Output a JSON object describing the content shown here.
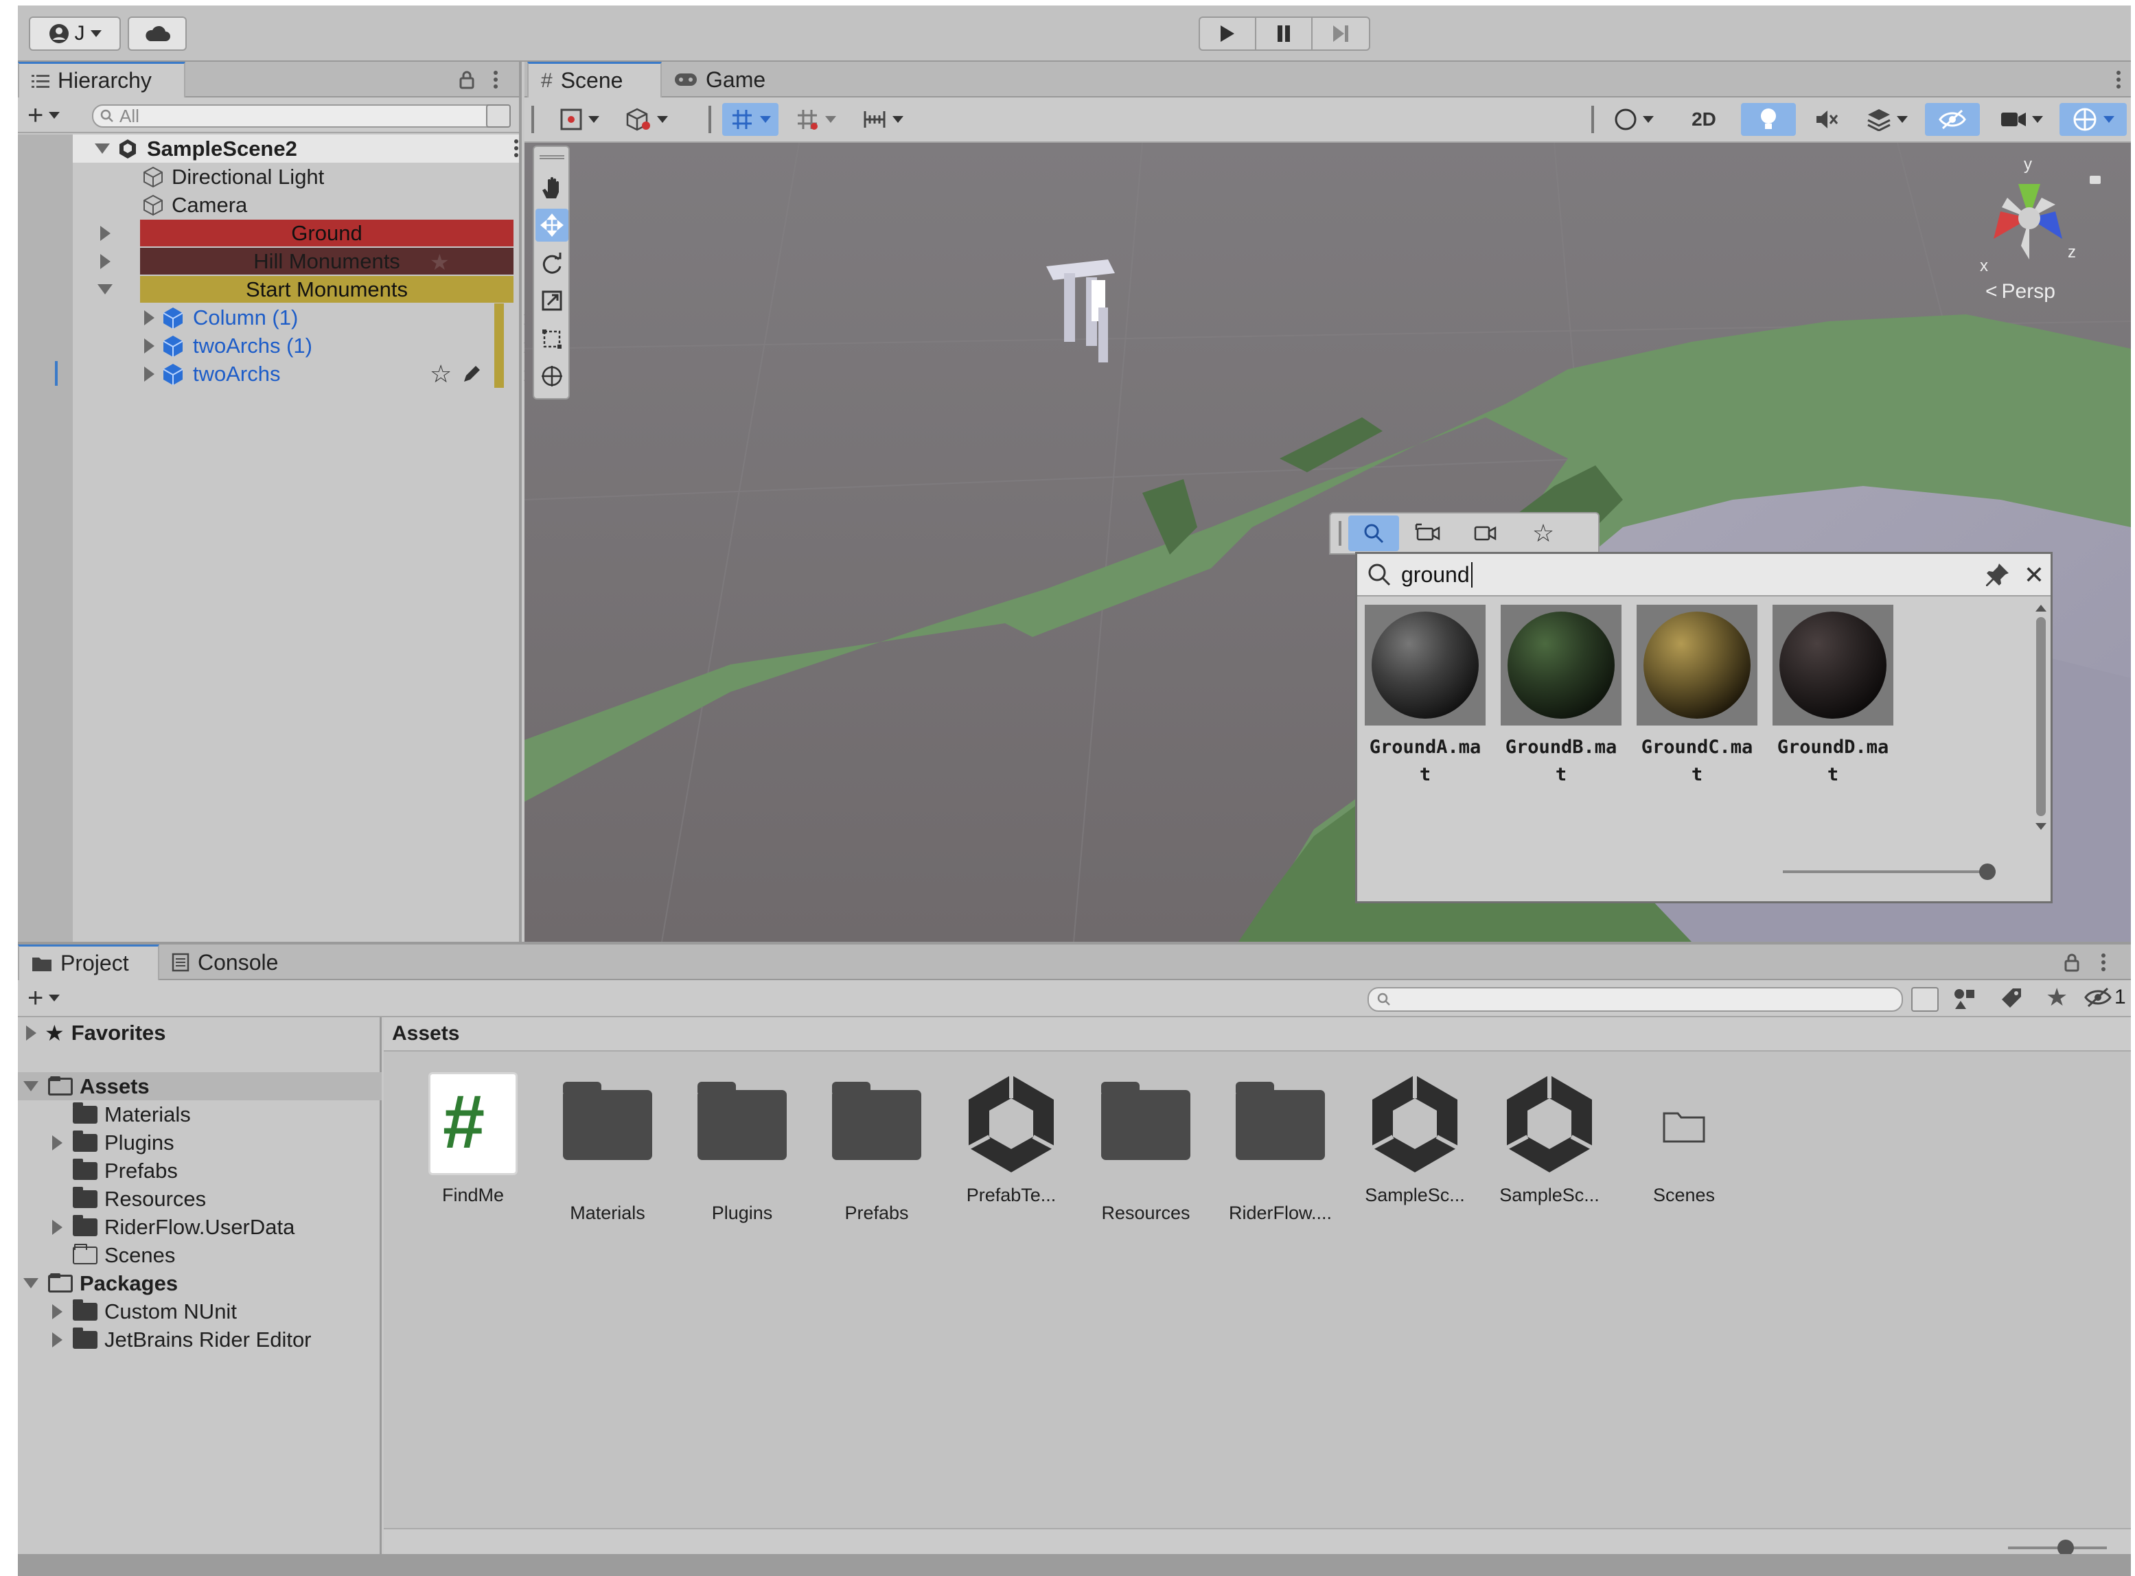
{
  "toolbar": {
    "account_label": "J",
    "cloud_icon": "cloud-icon",
    "play_icon": "play-icon",
    "pause_icon": "pause-icon",
    "step_icon": "step-icon"
  },
  "hierarchy": {
    "tab_label": "Hierarchy",
    "search_placeholder": "All",
    "scene_name": "SampleScene2",
    "items": [
      {
        "label": "Directional Light"
      },
      {
        "label": "Camera"
      },
      {
        "label": "Ground",
        "color": "#b02f2f"
      },
      {
        "label": "Hill Monuments",
        "color": "#5a2e2e"
      },
      {
        "label": "Start Monuments",
        "color": "#b5a03a"
      },
      {
        "label": "Column (1)"
      },
      {
        "label": "twoArchs (1)"
      },
      {
        "label": "twoArchs"
      }
    ]
  },
  "scene": {
    "tabs": [
      {
        "label": "Scene"
      },
      {
        "label": "Game"
      }
    ],
    "mode_2d_label": "2D",
    "persp_label": "Persp",
    "gizmo_axes": {
      "x": "x",
      "y": "y",
      "z": "z"
    }
  },
  "overlay": {
    "search_value": "ground",
    "results": [
      {
        "name": "GroundA.mat",
        "color": "#3e3e3e"
      },
      {
        "name": "GroundB.mat",
        "color": "#2a3b24"
      },
      {
        "name": "GroundC.mat",
        "color": "#6a5a2c"
      },
      {
        "name": "GroundD.mat",
        "color": "#2a2424"
      }
    ],
    "zoom_slider": 1.0
  },
  "project": {
    "tabs": [
      {
        "label": "Project"
      },
      {
        "label": "Console"
      }
    ],
    "hidden_count": "1",
    "tree": {
      "favorites": "Favorites",
      "assets": "Assets",
      "asset_children": [
        "Materials",
        "Plugins",
        "Prefabs",
        "Resources",
        "RiderFlow.UserData",
        "Scenes"
      ],
      "packages": "Packages",
      "package_children": [
        "Custom NUnit",
        "JetBrains Rider Editor"
      ]
    },
    "breadcrumb": "Assets",
    "assets": [
      {
        "label": "FindMe",
        "kind": "script"
      },
      {
        "label": "Materials",
        "kind": "folder"
      },
      {
        "label": "Plugins",
        "kind": "folder"
      },
      {
        "label": "Prefabs",
        "kind": "folder"
      },
      {
        "label": "PrefabTe...",
        "kind": "unity"
      },
      {
        "label": "Resources",
        "kind": "folder"
      },
      {
        "label": "RiderFlow....",
        "kind": "folder"
      },
      {
        "label": "SampleSc...",
        "kind": "unity"
      },
      {
        "label": "SampleSc...",
        "kind": "unity"
      },
      {
        "label": "Scenes",
        "kind": "empty-folder"
      }
    ],
    "icon_size_slider": 0.6
  }
}
